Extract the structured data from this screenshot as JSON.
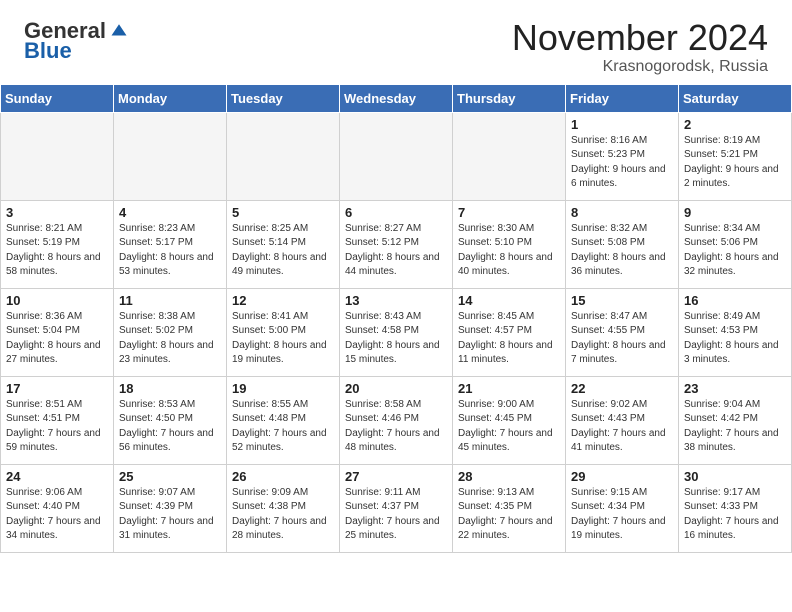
{
  "header": {
    "logo_general": "General",
    "logo_blue": "Blue",
    "month_title": "November 2024",
    "location": "Krasnogorodsk, Russia"
  },
  "days_of_week": [
    "Sunday",
    "Monday",
    "Tuesday",
    "Wednesday",
    "Thursday",
    "Friday",
    "Saturday"
  ],
  "weeks": [
    [
      {
        "day": "",
        "info": ""
      },
      {
        "day": "",
        "info": ""
      },
      {
        "day": "",
        "info": ""
      },
      {
        "day": "",
        "info": ""
      },
      {
        "day": "",
        "info": ""
      },
      {
        "day": "1",
        "info": "Sunrise: 8:16 AM\nSunset: 5:23 PM\nDaylight: 9 hours\nand 6 minutes."
      },
      {
        "day": "2",
        "info": "Sunrise: 8:19 AM\nSunset: 5:21 PM\nDaylight: 9 hours\nand 2 minutes."
      }
    ],
    [
      {
        "day": "3",
        "info": "Sunrise: 8:21 AM\nSunset: 5:19 PM\nDaylight: 8 hours\nand 58 minutes."
      },
      {
        "day": "4",
        "info": "Sunrise: 8:23 AM\nSunset: 5:17 PM\nDaylight: 8 hours\nand 53 minutes."
      },
      {
        "day": "5",
        "info": "Sunrise: 8:25 AM\nSunset: 5:14 PM\nDaylight: 8 hours\nand 49 minutes."
      },
      {
        "day": "6",
        "info": "Sunrise: 8:27 AM\nSunset: 5:12 PM\nDaylight: 8 hours\nand 44 minutes."
      },
      {
        "day": "7",
        "info": "Sunrise: 8:30 AM\nSunset: 5:10 PM\nDaylight: 8 hours\nand 40 minutes."
      },
      {
        "day": "8",
        "info": "Sunrise: 8:32 AM\nSunset: 5:08 PM\nDaylight: 8 hours\nand 36 minutes."
      },
      {
        "day": "9",
        "info": "Sunrise: 8:34 AM\nSunset: 5:06 PM\nDaylight: 8 hours\nand 32 minutes."
      }
    ],
    [
      {
        "day": "10",
        "info": "Sunrise: 8:36 AM\nSunset: 5:04 PM\nDaylight: 8 hours\nand 27 minutes."
      },
      {
        "day": "11",
        "info": "Sunrise: 8:38 AM\nSunset: 5:02 PM\nDaylight: 8 hours\nand 23 minutes."
      },
      {
        "day": "12",
        "info": "Sunrise: 8:41 AM\nSunset: 5:00 PM\nDaylight: 8 hours\nand 19 minutes."
      },
      {
        "day": "13",
        "info": "Sunrise: 8:43 AM\nSunset: 4:58 PM\nDaylight: 8 hours\nand 15 minutes."
      },
      {
        "day": "14",
        "info": "Sunrise: 8:45 AM\nSunset: 4:57 PM\nDaylight: 8 hours\nand 11 minutes."
      },
      {
        "day": "15",
        "info": "Sunrise: 8:47 AM\nSunset: 4:55 PM\nDaylight: 8 hours\nand 7 minutes."
      },
      {
        "day": "16",
        "info": "Sunrise: 8:49 AM\nSunset: 4:53 PM\nDaylight: 8 hours\nand 3 minutes."
      }
    ],
    [
      {
        "day": "17",
        "info": "Sunrise: 8:51 AM\nSunset: 4:51 PM\nDaylight: 7 hours\nand 59 minutes."
      },
      {
        "day": "18",
        "info": "Sunrise: 8:53 AM\nSunset: 4:50 PM\nDaylight: 7 hours\nand 56 minutes."
      },
      {
        "day": "19",
        "info": "Sunrise: 8:55 AM\nSunset: 4:48 PM\nDaylight: 7 hours\nand 52 minutes."
      },
      {
        "day": "20",
        "info": "Sunrise: 8:58 AM\nSunset: 4:46 PM\nDaylight: 7 hours\nand 48 minutes."
      },
      {
        "day": "21",
        "info": "Sunrise: 9:00 AM\nSunset: 4:45 PM\nDaylight: 7 hours\nand 45 minutes."
      },
      {
        "day": "22",
        "info": "Sunrise: 9:02 AM\nSunset: 4:43 PM\nDaylight: 7 hours\nand 41 minutes."
      },
      {
        "day": "23",
        "info": "Sunrise: 9:04 AM\nSunset: 4:42 PM\nDaylight: 7 hours\nand 38 minutes."
      }
    ],
    [
      {
        "day": "24",
        "info": "Sunrise: 9:06 AM\nSunset: 4:40 PM\nDaylight: 7 hours\nand 34 minutes."
      },
      {
        "day": "25",
        "info": "Sunrise: 9:07 AM\nSunset: 4:39 PM\nDaylight: 7 hours\nand 31 minutes."
      },
      {
        "day": "26",
        "info": "Sunrise: 9:09 AM\nSunset: 4:38 PM\nDaylight: 7 hours\nand 28 minutes."
      },
      {
        "day": "27",
        "info": "Sunrise: 9:11 AM\nSunset: 4:37 PM\nDaylight: 7 hours\nand 25 minutes."
      },
      {
        "day": "28",
        "info": "Sunrise: 9:13 AM\nSunset: 4:35 PM\nDaylight: 7 hours\nand 22 minutes."
      },
      {
        "day": "29",
        "info": "Sunrise: 9:15 AM\nSunset: 4:34 PM\nDaylight: 7 hours\nand 19 minutes."
      },
      {
        "day": "30",
        "info": "Sunrise: 9:17 AM\nSunset: 4:33 PM\nDaylight: 7 hours\nand 16 minutes."
      }
    ]
  ]
}
